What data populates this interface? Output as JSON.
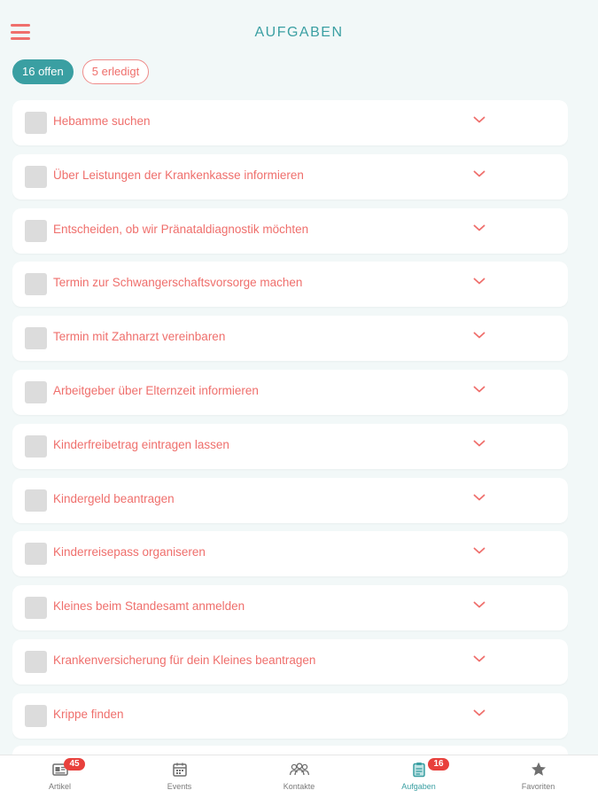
{
  "header": {
    "title": "AUFGABEN",
    "menu_icon": "hamburger-menu-icon"
  },
  "filters": {
    "open_label": "16 offen",
    "done_label": "5 erledigt"
  },
  "tasks": [
    {
      "label": "Hebamme suchen"
    },
    {
      "label": "Über Leistungen der Krankenkasse informieren"
    },
    {
      "label": "Entscheiden, ob wir Pränataldiagnostik möchten"
    },
    {
      "label": "Termin zur Schwangerschaftsvorsorge machen"
    },
    {
      "label": "Termin mit Zahnarzt vereinbaren"
    },
    {
      "label": "Arbeitgeber über Elternzeit informieren"
    },
    {
      "label": "Kinderfreibetrag eintragen lassen"
    },
    {
      "label": "Kindergeld beantragen"
    },
    {
      "label": "Kinderreisepass organiseren"
    },
    {
      "label": "Kleines beim Standesamt anmelden"
    },
    {
      "label": "Krankenversicherung für dein Kleines beantragen"
    },
    {
      "label": "Krippe finden"
    }
  ],
  "tabbar": {
    "tabs": [
      {
        "label": "Artikel",
        "icon": "newspaper-icon",
        "badge": "45"
      },
      {
        "label": "Events",
        "icon": "calendar-icon"
      },
      {
        "label": "Kontakte",
        "icon": "contacts-icon"
      },
      {
        "label": "Aufgaben",
        "icon": "clipboard-icon",
        "badge": "16",
        "active": true
      },
      {
        "label": "Favoriten",
        "icon": "star-icon"
      }
    ]
  },
  "colors": {
    "accent_teal": "#3a9fa2",
    "task_text_coral": "#ef6f6c",
    "badge_red": "#e8403c",
    "background": "#f2f8f8"
  }
}
